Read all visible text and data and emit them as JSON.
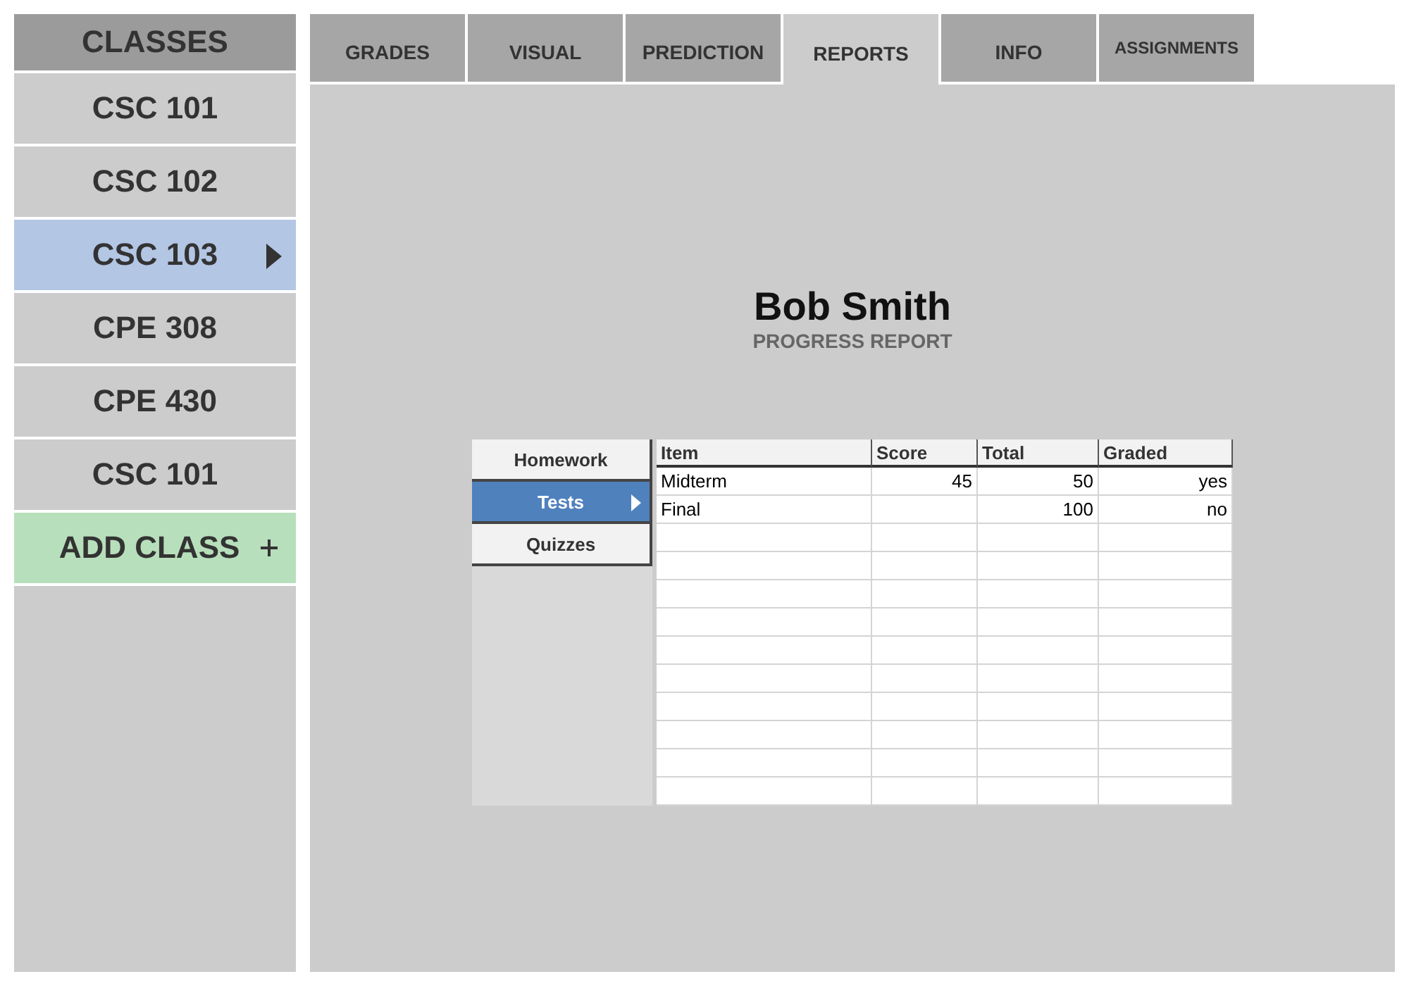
{
  "sidebar": {
    "title": "CLASSES",
    "items": [
      {
        "label": "CSC 101",
        "kind": "class",
        "selected": false
      },
      {
        "label": "CSC 102",
        "kind": "class",
        "selected": false
      },
      {
        "label": "CSC 103",
        "kind": "class",
        "selected": true
      },
      {
        "label": "CPE 308",
        "kind": "class",
        "selected": false
      },
      {
        "label": "CPE 430",
        "kind": "class",
        "selected": false
      },
      {
        "label": "CSC 101",
        "kind": "class",
        "selected": false
      },
      {
        "label": "ADD CLASS",
        "kind": "add"
      }
    ]
  },
  "tabs": [
    {
      "label": "GRADES",
      "selected": false
    },
    {
      "label": "VISUAL",
      "selected": false
    },
    {
      "label": "PREDICTION",
      "selected": false
    },
    {
      "label": "REPORTS",
      "selected": true
    },
    {
      "label": "INFO",
      "selected": false
    },
    {
      "label": "ASSIGNMENTS",
      "selected": false
    }
  ],
  "report": {
    "name": "Bob Smith",
    "subtitle": "PROGRESS REPORT",
    "categories": [
      {
        "label": "Homework",
        "selected": false
      },
      {
        "label": "Tests",
        "selected": true
      },
      {
        "label": "Quizzes",
        "selected": false
      }
    ],
    "table": {
      "columns": [
        "Item",
        "Score",
        "Total",
        "Graded"
      ],
      "rows": [
        [
          "Midterm",
          "45",
          "50",
          "yes"
        ],
        [
          "Final",
          "",
          "100",
          "no"
        ]
      ]
    }
  }
}
